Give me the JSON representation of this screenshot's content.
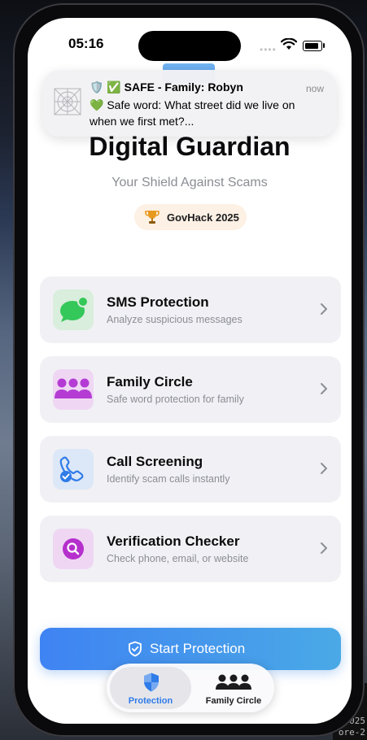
{
  "status": {
    "time": "05:16",
    "dots": "••••"
  },
  "notification": {
    "title": "🛡️ ✅ SAFE - Family: Robyn",
    "time": "now",
    "body": "💚 Safe word: What street did we live on when we first met?..."
  },
  "app": {
    "title": "Digital Guardian",
    "subtitle": "Your Shield Against Scams",
    "badge": "GovHack 2025"
  },
  "cards": [
    {
      "title": "SMS Protection",
      "subtitle": "Analyze suspicious messages",
      "icon": "message-bubble-icon",
      "color": "#34c759"
    },
    {
      "title": "Family Circle",
      "subtitle": "Safe word protection for family",
      "icon": "family-icon",
      "color": "#b43cd4"
    },
    {
      "title": "Call Screening",
      "subtitle": "Identify scam calls instantly",
      "icon": "phone-check-icon",
      "color": "#2f7be8"
    },
    {
      "title": "Verification Checker",
      "subtitle": "Check phone, email, or website",
      "icon": "magnifier-icon",
      "color": "#b530cc"
    }
  ],
  "start_button": {
    "label": "Start Protection"
  },
  "tabs": [
    {
      "label": "Protection",
      "selected": true,
      "color": "#2f7be8"
    },
    {
      "label": "Family Circle",
      "selected": false,
      "color": "#1c1c1e"
    }
  ],
  "backdrop_terminal": [
    "025",
    "ore-2"
  ]
}
